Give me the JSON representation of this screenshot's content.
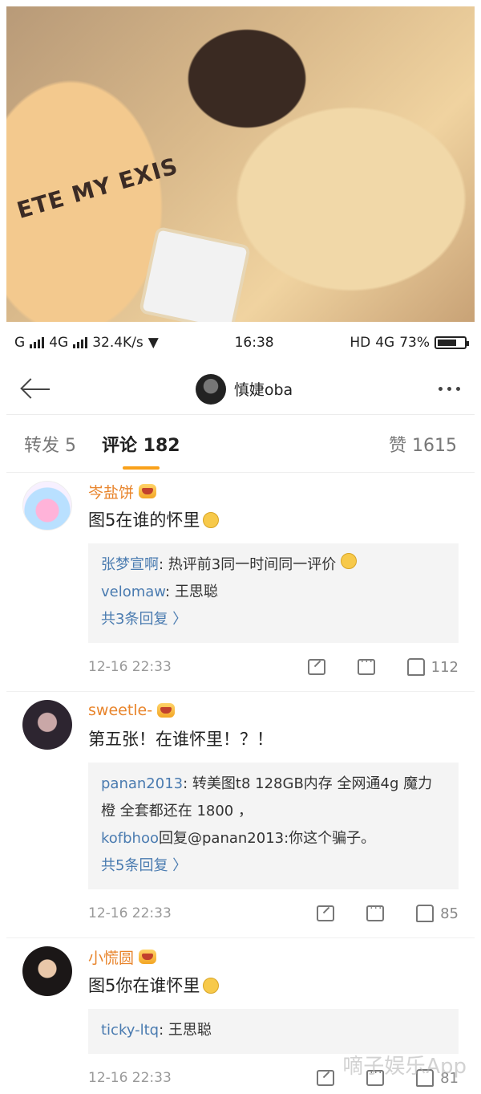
{
  "photo": {
    "shirt_text": "ETE MY EXIS"
  },
  "statusbar": {
    "network1": "G",
    "network2": "4G",
    "speed": "32.4K/s",
    "time": "16:38",
    "hd": "HD",
    "network3": "4G",
    "battery_pct": "73%",
    "battery_level": 0.73
  },
  "header": {
    "username": "慎婕oba"
  },
  "tabs": [
    {
      "label": "转发 5"
    },
    {
      "label": "评论 182"
    },
    {
      "label": "赞 1615"
    }
  ],
  "comments": [
    {
      "username": "岑盐饼",
      "text": "图5在谁的怀里",
      "replies": [
        {
          "name": "张梦宣啊",
          "text": ": 热评前3同一时间同一评价"
        },
        {
          "name": "velomaw",
          "text": ": 王思聪"
        }
      ],
      "more": "共3条回复 〉",
      "time": "12-16 22:33",
      "likes": "112"
    },
    {
      "username": "sweetle-",
      "text": "第五张！在谁怀里！？！",
      "replies": [
        {
          "name": "panan2013",
          "text": ": 转美图t8 128GB内存 全网通4g 魔力橙 全套都还在 1800 ，"
        },
        {
          "name": "kofbhoo",
          "text": "回复@panan2013:你这个骗子。"
        }
      ],
      "more": "共5条回复 〉",
      "time": "12-16 22:33",
      "likes": "85"
    },
    {
      "username": "小慌圆",
      "text": "图5你在谁怀里",
      "replies": [
        {
          "name": "ticky-ltq",
          "text": ": 王思聪"
        }
      ],
      "time": "12-16 22:33",
      "likes": "81"
    }
  ],
  "watermark": "嘀子娱乐App"
}
